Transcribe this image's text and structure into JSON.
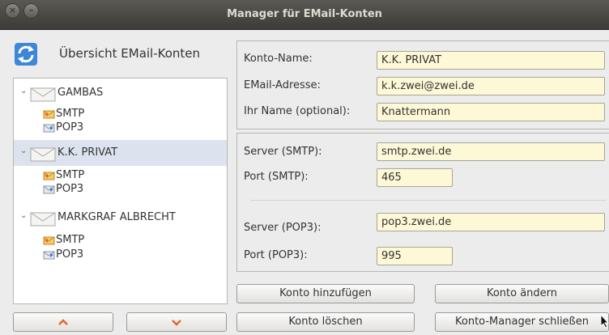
{
  "window": {
    "title": "Manager für EMail-Konten",
    "close_glyph": "×",
    "minimize_glyph": "–"
  },
  "overview": {
    "title": "Übersicht EMail-Konten",
    "icon": "sync-icon"
  },
  "tree": {
    "accounts": [
      {
        "name": "GAMBAS",
        "selected": false,
        "children": [
          "SMTP",
          "POP3"
        ]
      },
      {
        "name": "K.K. PRIVAT",
        "selected": true,
        "children": [
          "SMTP",
          "POP3"
        ]
      },
      {
        "name": "MARKGRAF ALBRECHT",
        "selected": false,
        "children": [
          "SMTP",
          "POP3"
        ]
      }
    ]
  },
  "nav": {
    "up_glyph": "⌃",
    "down_glyph": "⌄"
  },
  "account_form": {
    "konto_name_label": "Konto-Name:",
    "konto_name_value": "K.K. PRIVAT",
    "email_label": "EMail-Adresse:",
    "email_value": "k.k.zwei@zwei.de",
    "name_label": "Ihr Name (optional):",
    "name_value": "Knattermann"
  },
  "server_form": {
    "smtp_server_label": "Server (SMTP):",
    "smtp_server_value": "smtp.zwei.de",
    "smtp_port_label": "Port (SMTP):",
    "smtp_port_value": "465",
    "pop3_server_label": "Server (POP3):",
    "pop3_server_value": "pop3.zwei.de",
    "pop3_port_label": "Port (POP3):",
    "pop3_port_value": "995"
  },
  "buttons": {
    "add": "Konto hinzufügen",
    "change": "Konto ändern",
    "delete": "Konto löschen",
    "close": "Konto-Manager schließen"
  },
  "colors": {
    "titlebar": "#3c3b37",
    "field_bg": "#fdf8d6",
    "selection": "#dce3ee",
    "arrow_accent": "#e8632c"
  }
}
